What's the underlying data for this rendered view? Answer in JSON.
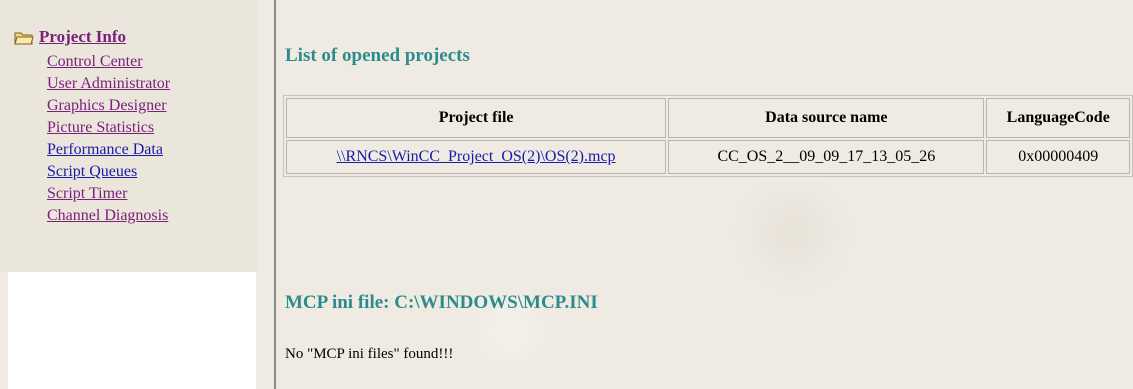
{
  "nav": {
    "root_label": "Project Info",
    "items": [
      {
        "label": "Control Center",
        "visited": true
      },
      {
        "label": "User Administrator",
        "visited": true
      },
      {
        "label": "Graphics Designer",
        "visited": true
      },
      {
        "label": "Picture Statistics",
        "visited": true
      },
      {
        "label": "Performance Data",
        "visited": false
      },
      {
        "label": "Script Queues",
        "visited": false
      },
      {
        "label": "Script Timer",
        "visited": true
      },
      {
        "label": "Channel Diagnosis",
        "visited": true
      }
    ]
  },
  "projects": {
    "heading": "List of opened projects",
    "columns": [
      "Project file",
      "Data source name",
      "LanguageCode"
    ],
    "rows": [
      {
        "file": "\\\\RNCS\\WinCC_Project_OS(2)\\OS(2).mcp",
        "data_source": "CC_OS_2__09_09_17_13_05_26",
        "language_code": "0x00000409"
      }
    ]
  },
  "mcp": {
    "heading": "MCP ini file: C:\\WINDOWS\\MCP.INI",
    "message": "No \"MCP ini files\" found!!!"
  },
  "colors": {
    "heading": "#2c8c8c",
    "visited_link": "#7a1f7a",
    "link": "#1a1aa6",
    "background": "#efebe3"
  },
  "icons": {
    "root": "folder-open-icon"
  }
}
